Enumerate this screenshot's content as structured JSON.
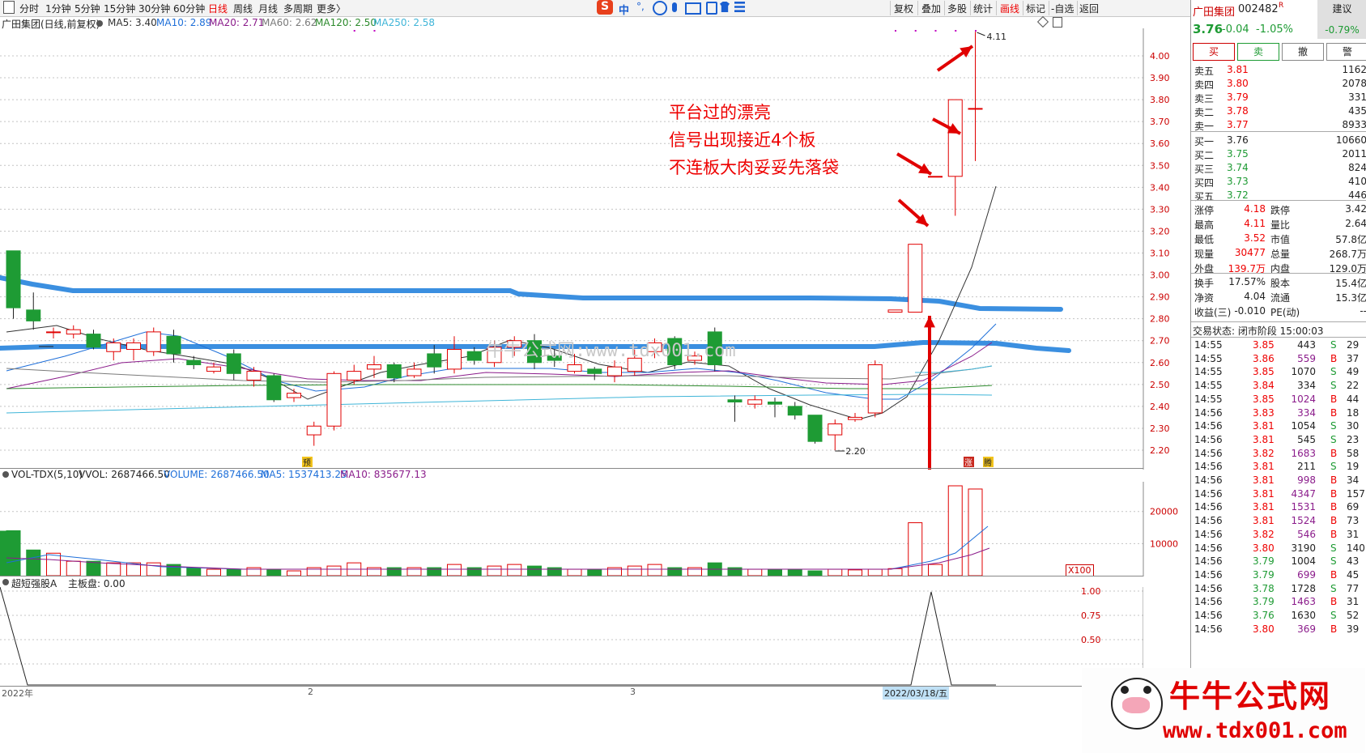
{
  "toolbar": {
    "periods": [
      "分时",
      "1分钟",
      "5分钟",
      "15分钟",
      "30分钟",
      "60分钟",
      "日线",
      "周线",
      "月线",
      "多周期",
      "更多〉"
    ],
    "active_period": "日线",
    "ime": "中",
    "right_tools": [
      "复权",
      "叠加",
      "多股",
      "统计",
      "画线",
      "标记",
      "-自选",
      "返回"
    ],
    "active_tool": "画线"
  },
  "indicator": {
    "title": "广田集团(日线,前复权)",
    "ma5": "MA5: 3.40",
    "ma10": "MA10: 2.89",
    "ma20": "MA20: 2.71",
    "ma60": "MA60: 2.62",
    "ma120": "MA120: 2.50",
    "ma250": "MA250: 2.58"
  },
  "price_axis": [
    "4.00",
    "3.90",
    "3.80",
    "3.70",
    "3.60",
    "3.50",
    "3.40",
    "3.30",
    "3.20",
    "3.10",
    "3.00",
    "2.90",
    "2.80",
    "2.70",
    "2.60",
    "2.50",
    "2.40",
    "2.30",
    "2.20"
  ],
  "chart": {
    "high_label": "4.11",
    "low_label": "2.20",
    "annotation": [
      "平台过的漂亮",
      "信号出现接近4个板",
      "不连板大肉妥妥先落袋"
    ],
    "watermark_text": "牛牛公式网:www.tdx001.com",
    "markers": [
      "预",
      "涨",
      "腾"
    ]
  },
  "volume": {
    "title": "VOL-TDX(5,10)",
    "vvol": "VVOL: 2687466.50",
    "volume": "VOLUME: 2687466.50",
    "ma5": "MA5: 1537413.25",
    "ma10": "MA10: 835677.13",
    "axis": [
      "20000",
      "10000"
    ],
    "unit": "X100"
  },
  "indicator2": {
    "title": "超短强股A",
    "main": "主板盘: 0.00",
    "axis": [
      "1.00",
      "0.75",
      "0.50"
    ]
  },
  "time_axis": [
    "2022年",
    "2",
    "3",
    "2022/03/18/五"
  ],
  "chart_data": {
    "type": "candlestick",
    "symbol": "广田集团",
    "code": "002482",
    "ylim": [
      2.15,
      4.15
    ],
    "candles": [
      {
        "o": 3.11,
        "c": 2.85,
        "h": 3.11,
        "l": 2.8
      },
      {
        "o": 2.84,
        "c": 2.79,
        "h": 2.92,
        "l": 2.75
      },
      {
        "o": 2.74,
        "c": 2.74,
        "h": 2.76,
        "l": 2.71
      },
      {
        "o": 2.73,
        "c": 2.75,
        "h": 2.77,
        "l": 2.71
      },
      {
        "o": 2.73,
        "c": 2.67,
        "h": 2.75,
        "l": 2.66
      },
      {
        "o": 2.65,
        "c": 2.69,
        "h": 2.71,
        "l": 2.61
      },
      {
        "o": 2.66,
        "c": 2.69,
        "h": 2.71,
        "l": 2.61
      },
      {
        "o": 2.65,
        "c": 2.74,
        "h": 2.76,
        "l": 2.63
      },
      {
        "o": 2.72,
        "c": 2.64,
        "h": 2.75,
        "l": 2.6
      },
      {
        "o": 2.61,
        "c": 2.59,
        "h": 2.63,
        "l": 2.57
      },
      {
        "o": 2.56,
        "c": 2.58,
        "h": 2.6,
        "l": 2.55
      },
      {
        "o": 2.64,
        "c": 2.55,
        "h": 2.66,
        "l": 2.52
      },
      {
        "o": 2.52,
        "c": 2.56,
        "h": 2.58,
        "l": 2.49
      },
      {
        "o": 2.54,
        "c": 2.43,
        "h": 2.55,
        "l": 2.42
      },
      {
        "o": 2.44,
        "c": 2.46,
        "h": 2.48,
        "l": 2.42
      },
      {
        "o": 2.27,
        "c": 2.31,
        "h": 2.33,
        "l": 2.22
      },
      {
        "o": 2.31,
        "c": 2.55,
        "h": 2.56,
        "l": 2.29
      },
      {
        "o": 2.52,
        "c": 2.56,
        "h": 2.59,
        "l": 2.5
      },
      {
        "o": 2.57,
        "c": 2.59,
        "h": 2.63,
        "l": 2.53
      },
      {
        "o": 2.59,
        "c": 2.53,
        "h": 2.6,
        "l": 2.51
      },
      {
        "o": 2.54,
        "c": 2.57,
        "h": 2.6,
        "l": 2.53
      },
      {
        "o": 2.64,
        "c": 2.58,
        "h": 2.68,
        "l": 2.55
      },
      {
        "o": 2.57,
        "c": 2.66,
        "h": 2.72,
        "l": 2.55
      },
      {
        "o": 2.65,
        "c": 2.61,
        "h": 2.67,
        "l": 2.59
      },
      {
        "o": 2.6,
        "c": 2.67,
        "h": 2.7,
        "l": 2.58
      },
      {
        "o": 2.67,
        "c": 2.7,
        "h": 2.72,
        "l": 2.63
      },
      {
        "o": 2.7,
        "c": 2.6,
        "h": 2.73,
        "l": 2.57
      },
      {
        "o": 2.63,
        "c": 2.61,
        "h": 2.66,
        "l": 2.58
      },
      {
        "o": 2.56,
        "c": 2.59,
        "h": 2.64,
        "l": 2.55
      },
      {
        "o": 2.57,
        "c": 2.55,
        "h": 2.58,
        "l": 2.52
      },
      {
        "o": 2.54,
        "c": 2.58,
        "h": 2.61,
        "l": 2.51
      },
      {
        "o": 2.56,
        "c": 2.62,
        "h": 2.66,
        "l": 2.54
      },
      {
        "o": 2.65,
        "c": 2.69,
        "h": 2.71,
        "l": 2.62
      },
      {
        "o": 2.71,
        "c": 2.59,
        "h": 2.72,
        "l": 2.57
      },
      {
        "o": 2.61,
        "c": 2.63,
        "h": 2.65,
        "l": 2.59
      },
      {
        "o": 2.74,
        "c": 2.59,
        "h": 2.76,
        "l": 2.56
      },
      {
        "o": 2.43,
        "c": 2.42,
        "h": 2.45,
        "l": 2.33
      },
      {
        "o": 2.41,
        "c": 2.43,
        "h": 2.45,
        "l": 2.39
      },
      {
        "o": 2.42,
        "c": 2.41,
        "h": 2.44,
        "l": 2.35
      },
      {
        "o": 2.4,
        "c": 2.36,
        "h": 2.42,
        "l": 2.34
      },
      {
        "o": 2.36,
        "c": 2.24,
        "h": 2.36,
        "l": 2.23
      },
      {
        "o": 2.27,
        "c": 2.32,
        "h": 2.34,
        "l": 2.2
      },
      {
        "o": 2.34,
        "c": 2.35,
        "h": 2.37,
        "l": 2.33
      },
      {
        "o": 2.37,
        "c": 2.59,
        "h": 2.61,
        "l": 2.35
      },
      {
        "o": 2.83,
        "c": 2.84,
        "h": 2.84,
        "l": 2.83
      },
      {
        "o": 2.83,
        "c": 3.14,
        "h": 3.14,
        "l": 2.83
      },
      {
        "o": 3.45,
        "c": 3.45,
        "h": 3.45,
        "l": 3.45
      },
      {
        "o": 3.45,
        "c": 3.8,
        "h": 3.8,
        "l": 3.27
      },
      {
        "o": 3.76,
        "c": 3.76,
        "h": 4.11,
        "l": 3.52
      }
    ],
    "support_lines": [
      3.05,
      2.82
    ],
    "volumes": [
      14000,
      8000,
      7000,
      4500,
      4500,
      4000,
      4000,
      4000,
      3500,
      2500,
      2000,
      2000,
      2500,
      2000,
      1500,
      2500,
      3000,
      4000,
      2500,
      2500,
      2500,
      2500,
      3500,
      2500,
      3000,
      3500,
      3000,
      2500,
      2000,
      2000,
      2500,
      3000,
      3500,
      2500,
      2500,
      4000,
      2500,
      2000,
      2000,
      2000,
      1500,
      2000,
      1800,
      2000,
      2200,
      16500,
      3500,
      28000,
      27000
    ],
    "vol_ylim": [
      0,
      28000
    ]
  },
  "quote": {
    "name": "广田集团",
    "code": "002482",
    "mark": "R",
    "advice": "建议",
    "price": "3.76",
    "change": "-0.04",
    "pct": "-1.05%",
    "advice_pct": "-0.79%",
    "buttons": [
      "买",
      "卖",
      "撤",
      "警"
    ],
    "asks": [
      {
        "label": "卖五",
        "price": "3.81",
        "vol": "1162"
      },
      {
        "label": "卖四",
        "price": "3.80",
        "vol": "2078"
      },
      {
        "label": "卖三",
        "price": "3.79",
        "vol": "331"
      },
      {
        "label": "卖二",
        "price": "3.78",
        "vol": "435"
      },
      {
        "label": "卖一",
        "price": "3.77",
        "vol": "8933"
      }
    ],
    "bids": [
      {
        "label": "买一",
        "price": "3.76",
        "vol": "10660"
      },
      {
        "label": "买二",
        "price": "3.75",
        "vol": "2011"
      },
      {
        "label": "买三",
        "price": "3.74",
        "vol": "824"
      },
      {
        "label": "买四",
        "price": "3.73",
        "vol": "410"
      },
      {
        "label": "买五",
        "price": "3.72",
        "vol": "446"
      }
    ],
    "stats": [
      {
        "k1": "涨停",
        "v1": "4.18",
        "k2": "跌停",
        "v2": "3.42"
      },
      {
        "k1": "最高",
        "v1": "4.11",
        "k2": "量比",
        "v2": "2.64"
      },
      {
        "k1": "最低",
        "v1": "3.52",
        "k2": "市值",
        "v2": "57.8亿"
      },
      {
        "k1": "现量",
        "v1": "30477",
        "k2": "总量",
        "v2": "268.7万"
      },
      {
        "k1": "外盘",
        "v1": "139.7万",
        "k2": "内盘",
        "v2": "129.0万"
      }
    ],
    "stats2": [
      {
        "k1": "换手",
        "v1": "17.57%",
        "k2": "股本",
        "v2": "15.4亿"
      },
      {
        "k1": "净资",
        "v1": "4.04",
        "k2": "流通",
        "v2": "15.3亿"
      },
      {
        "k1": "收益(三)",
        "v1": "-0.010",
        "k2": "PE(动)",
        "v2": "--"
      }
    ],
    "status": "交易状态: 闭市阶段 15:00:03",
    "ticks": [
      {
        "t": "14:55",
        "p": "3.85",
        "v": "443",
        "s": "S",
        "x": "29"
      },
      {
        "t": "14:55",
        "p": "3.86",
        "v": "559",
        "s": "B",
        "x": "37"
      },
      {
        "t": "14:55",
        "p": "3.85",
        "v": "1070",
        "s": "S",
        "x": "49"
      },
      {
        "t": "14:55",
        "p": "3.84",
        "v": "334",
        "s": "S",
        "x": "22"
      },
      {
        "t": "14:55",
        "p": "3.85",
        "v": "1024",
        "s": "B",
        "x": "44"
      },
      {
        "t": "14:56",
        "p": "3.83",
        "v": "334",
        "s": "B",
        "x": "18"
      },
      {
        "t": "14:56",
        "p": "3.81",
        "v": "1054",
        "s": "S",
        "x": "30"
      },
      {
        "t": "14:56",
        "p": "3.81",
        "v": "545",
        "s": "S",
        "x": "23"
      },
      {
        "t": "14:56",
        "p": "3.82",
        "v": "1683",
        "s": "B",
        "x": "58"
      },
      {
        "t": "14:56",
        "p": "3.81",
        "v": "211",
        "s": "S",
        "x": "19"
      },
      {
        "t": "14:56",
        "p": "3.81",
        "v": "998",
        "s": "B",
        "x": "34"
      },
      {
        "t": "14:56",
        "p": "3.81",
        "v": "4347",
        "s": "B",
        "x": "157"
      },
      {
        "t": "14:56",
        "p": "3.81",
        "v": "1531",
        "s": "B",
        "x": "69"
      },
      {
        "t": "14:56",
        "p": "3.81",
        "v": "1524",
        "s": "B",
        "x": "73"
      },
      {
        "t": "14:56",
        "p": "3.82",
        "v": "546",
        "s": "B",
        "x": "31"
      },
      {
        "t": "14:56",
        "p": "3.80",
        "v": "3190",
        "s": "S",
        "x": "140"
      },
      {
        "t": "14:56",
        "p": "3.79",
        "v": "1004",
        "s": "S",
        "x": "43"
      },
      {
        "t": "14:56",
        "p": "3.79",
        "v": "699",
        "s": "B",
        "x": "45"
      },
      {
        "t": "14:56",
        "p": "3.78",
        "v": "1728",
        "s": "S",
        "x": "77"
      },
      {
        "t": "14:56",
        "p": "3.79",
        "v": "1463",
        "s": "B",
        "x": "31"
      },
      {
        "t": "14:56",
        "p": "3.76",
        "v": "1630",
        "s": "S",
        "x": "52"
      },
      {
        "t": "14:56",
        "p": "3.80",
        "v": "369",
        "s": "B",
        "x": "39"
      }
    ]
  },
  "logo": {
    "title": "牛牛公式网",
    "url": "www.tdx001.com"
  },
  "colors": {
    "up": "#e00000",
    "down": "#1e9b34",
    "ma5": "#333333",
    "ma10": "#1e6fd9",
    "ma20": "#8b1c8b",
    "ma60": "#7a7a7a",
    "ma120": "#2c8a2c",
    "ma250": "#3fb5d8",
    "support": "#3b8fe0",
    "annot": "#e00000"
  }
}
